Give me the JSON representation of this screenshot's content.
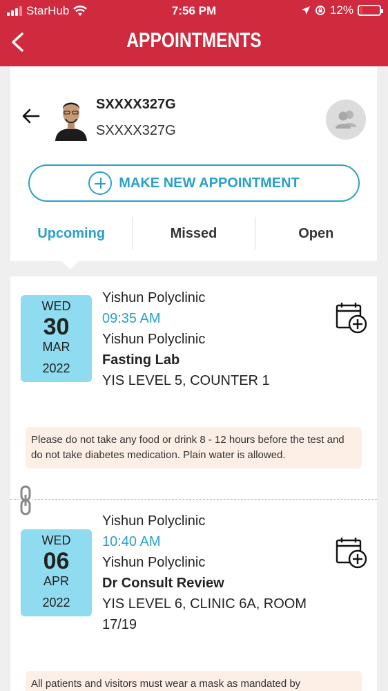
{
  "status_bar": {
    "carrier": "StarHub",
    "time": "7:56 PM",
    "battery": "12%",
    "battery_level": 0.12
  },
  "header": {
    "title": "APPOINTMENTS",
    "back_icon": "chevron-left-icon"
  },
  "profile": {
    "name": "SXXXX327G",
    "id": "SXXXX327G"
  },
  "make_button": {
    "label": "MAKE NEW APPOINTMENT"
  },
  "tabs": [
    {
      "label": "Upcoming",
      "active": true
    },
    {
      "label": "Missed",
      "active": false
    },
    {
      "label": "Open",
      "active": false
    }
  ],
  "appointments": [
    {
      "dow": "WED",
      "day": "30",
      "month": "MAR",
      "year": "2022",
      "clinic": "Yishun Polyclinic",
      "time": "09:35 AM",
      "location": "Yishun Polyclinic",
      "service": "Fasting Lab",
      "venue": "YIS LEVEL 5, COUNTER 1",
      "note": "Please do not take any food or drink 8 - 12 hours before the test and do not take diabetes medication. Plain water is allowed."
    },
    {
      "dow": "WED",
      "day": "06",
      "month": "APR",
      "year": "2022",
      "clinic": "Yishun Polyclinic",
      "time": "10:40 AM",
      "location": "Yishun Polyclinic",
      "service": "Dr Consult Review",
      "venue": "YIS LEVEL 6, CLINIC 6A, ROOM 17/19",
      "note": "All patients and visitors must wear a mask as mandated by"
    }
  ],
  "colors": {
    "brand_red": "#cf2a3e",
    "accent_blue": "#2aa0c8",
    "date_box": "#8fdcf0",
    "note_bg": "#fdeee6"
  }
}
